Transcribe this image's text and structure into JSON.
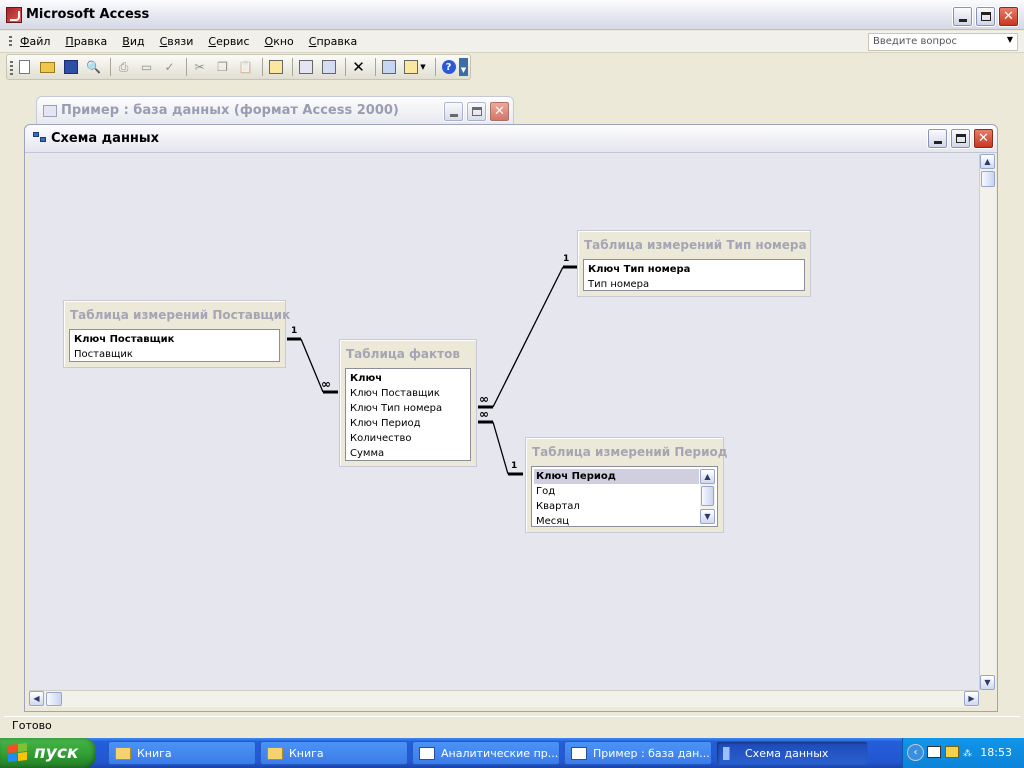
{
  "app": {
    "title": "Microsoft Access"
  },
  "menu": {
    "items": [
      "Файл",
      "Правка",
      "Вид",
      "Связи",
      "Сервис",
      "Окно",
      "Справка"
    ],
    "ask_placeholder": "Введите вопрос"
  },
  "toolbar": {
    "icons": [
      "new-icon",
      "open-icon",
      "save-icon",
      "search-icon",
      "print-icon",
      "preview-icon",
      "spell-icon",
      "cut-icon",
      "copy-icon",
      "paste-icon",
      "add-table-icon",
      "show-direct-icon",
      "show-all-icon",
      "delete-icon",
      "new-object-icon",
      "new-object-dropdown-icon",
      "help-icon"
    ]
  },
  "db_window": {
    "title": "Пример : база данных (формат Access 2000)"
  },
  "schema_window": {
    "title": "Схема данных"
  },
  "tables": [
    {
      "title": "Таблица измерений Поставщик",
      "fields": [
        {
          "name": "Ключ Поставщик",
          "pk": true
        },
        {
          "name": "Поставщик",
          "pk": false
        }
      ]
    },
    {
      "title": "Таблица фактов",
      "fields": [
        {
          "name": "Ключ",
          "pk": true
        },
        {
          "name": "Ключ  Поставщик",
          "pk": false
        },
        {
          "name": "Ключ Тип номера",
          "pk": false
        },
        {
          "name": "Ключ Период",
          "pk": false
        },
        {
          "name": "Количество",
          "pk": false
        },
        {
          "name": "Сумма",
          "pk": false
        }
      ]
    },
    {
      "title": "Таблица измерений Тип номера",
      "fields": [
        {
          "name": "Ключ Тип номера",
          "pk": true
        },
        {
          "name": "Тип номера",
          "pk": false
        }
      ]
    },
    {
      "title": "Таблица измерений Период",
      "fields": [
        {
          "name": "Ключ Период",
          "pk": true
        },
        {
          "name": "Год",
          "pk": false
        },
        {
          "name": "Квартал",
          "pk": false
        },
        {
          "name": "Месяц",
          "pk": false
        }
      ]
    }
  ],
  "relations": {
    "one": "1",
    "many": "∞"
  },
  "status": {
    "text": "Готово"
  },
  "taskbar": {
    "start": "пуск",
    "tasks": [
      "Книга",
      "Книга",
      "Аналитические пр...",
      "Пример : база дан...",
      "Схема данных"
    ],
    "clock": "18:53"
  }
}
